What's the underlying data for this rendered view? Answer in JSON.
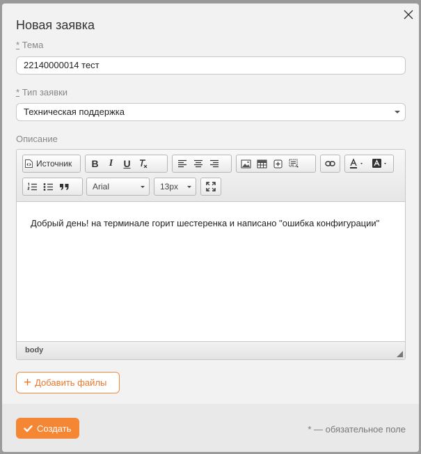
{
  "modal": {
    "title": "Новая заявка",
    "close_icon": "close-icon"
  },
  "fields": {
    "subject": {
      "required_mark": "*",
      "label": "Тема",
      "value": "22140000014 тест"
    },
    "type": {
      "required_mark": "*",
      "label": "Тип заявки",
      "value": "Техническая поддержка"
    },
    "description": {
      "label": "Описание"
    }
  },
  "editor": {
    "toolbar": {
      "source_label": "Источник",
      "bold": "B",
      "italic": "I",
      "underline": "U",
      "font": "Arial",
      "size": "13px"
    },
    "content": "Добрый день! на терминале горит шестеренка и написано \"ошибка конфигурации\"",
    "status_path": "body"
  },
  "add_files_label": "Добавить файлы",
  "footer": {
    "create_label": "Создать",
    "required_note": "* — обязательное поле"
  },
  "colors": {
    "accent": "#f58634",
    "background": "#f2f2f2"
  }
}
